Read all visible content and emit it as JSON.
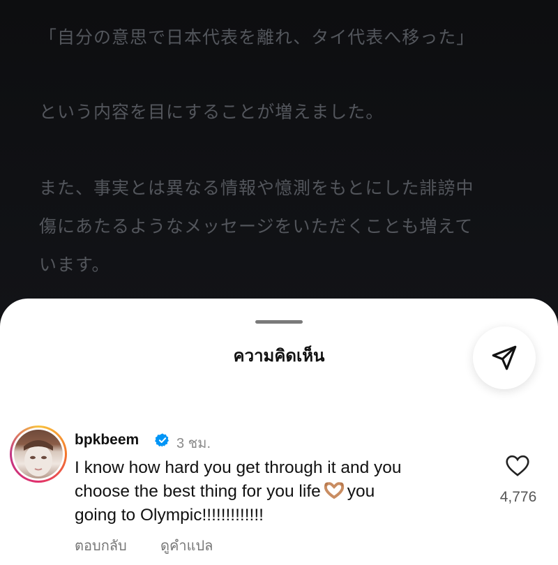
{
  "post": {
    "lines": [
      "「自分の意思で日本代表を離れ、タイ代表へ移った」",
      "という内容を目にすることが増えました。",
      "また、事実とは異なる情報や憶測をもとにした誹謗中",
      "傷にあたるようなメッセージをいただくことも増えて",
      "います。"
    ]
  },
  "sheet": {
    "title": "ความคิดเห็น",
    "share_icon": "send-icon"
  },
  "comment": {
    "username": "bpkbeem",
    "verified": true,
    "time": "3 ชม.",
    "line1": "I know how hard you get through it and you",
    "line2_before": "choose the best thing for you life",
    "line2_after": "you",
    "line3": "going to Olympic!!!!!!!!!!!!!",
    "emoji": "heart-hands-emoji",
    "likes": "4,776",
    "reply_label": "ตอบกลับ",
    "translate_label": "ดูคำแปล"
  },
  "colors": {
    "background": "#0f1012",
    "post_text": "#53565c",
    "verified_blue": "#0095f6",
    "secondary_text": "#777777"
  }
}
